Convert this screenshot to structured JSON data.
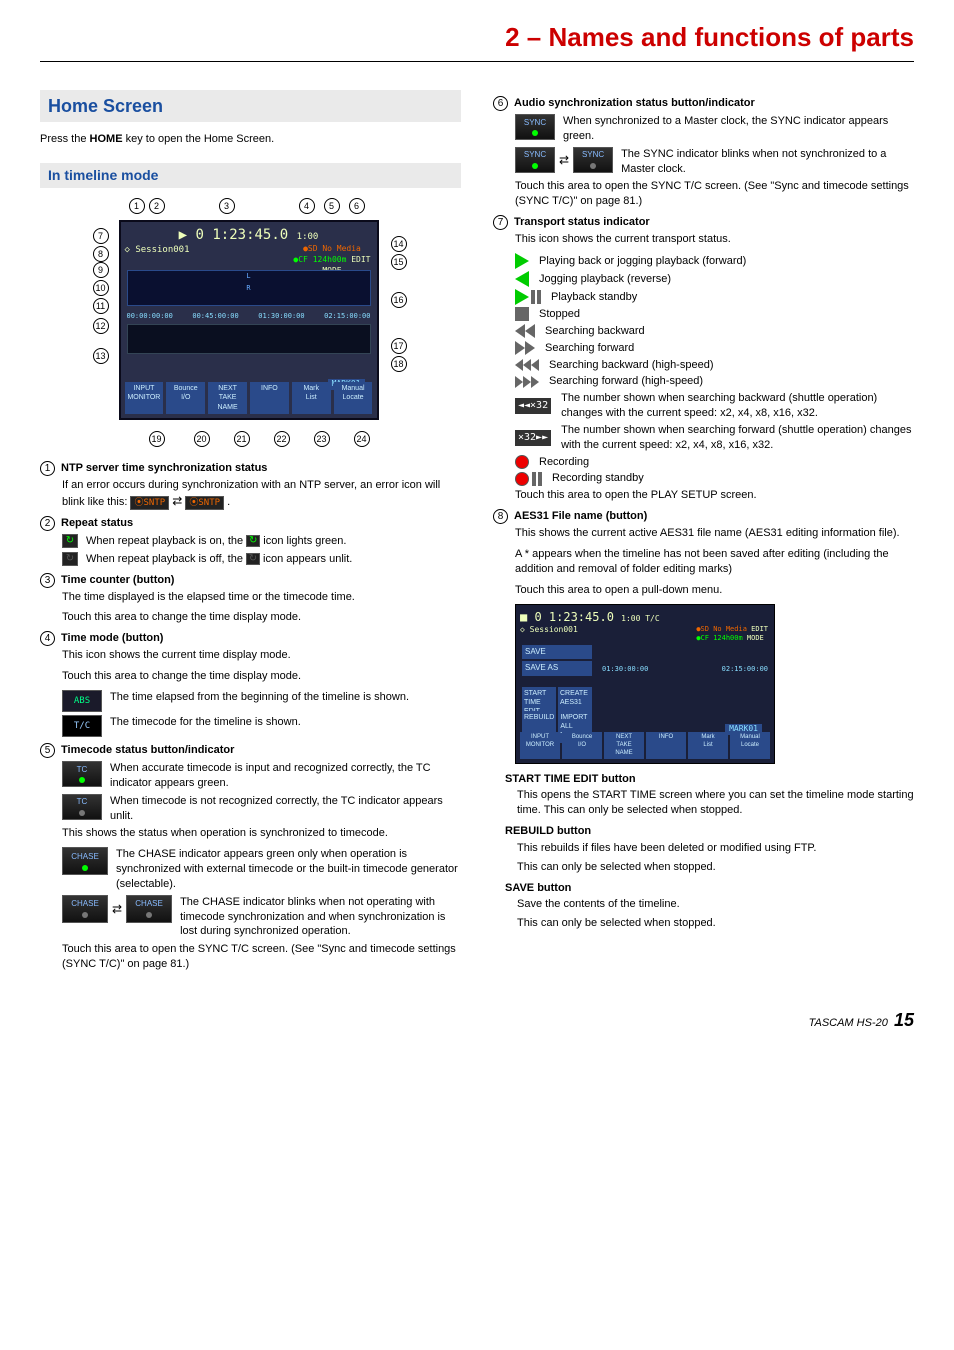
{
  "chapter_title": "2 – Names and functions of parts",
  "section": {
    "home_screen": "Home Screen",
    "timeline_mode": "In timeline mode"
  },
  "intro": {
    "prefix": "Press the ",
    "key": "HOME",
    "suffix": " key to open the Home Screen."
  },
  "callouts_top": [
    "1",
    "2",
    "3",
    "4",
    "5",
    "6"
  ],
  "callouts_left": [
    "7",
    "8",
    "9",
    "10",
    "11",
    "12",
    "13"
  ],
  "callouts_right": [
    "14",
    "15",
    "16",
    "17",
    "18"
  ],
  "callouts_bottom": [
    "19",
    "20",
    "21",
    "22",
    "23",
    "24"
  ],
  "col1": {
    "i1": {
      "num": "1",
      "title": "NTP server time synchronization status",
      "body": "If an error occurs during synchronization with an NTP server, an error icon will blink like this:",
      "sntp": "⦿SNTP",
      "dot": "."
    },
    "i2": {
      "num": "2",
      "title": "Repeat status",
      "on_a": "When repeat playback is on, the ",
      "on_b": " icon lights green.",
      "off_a": "When repeat playback is off, the ",
      "off_b": " icon appears unlit."
    },
    "i3": {
      "num": "3",
      "title": "Time counter (button)",
      "l1": "The time displayed is the elapsed time or the timecode time.",
      "l2": "Touch this area to change the time display mode."
    },
    "i4": {
      "num": "4",
      "title": "Time mode (button)",
      "l1": "This icon shows the current time display mode.",
      "l2": "Touch this area to change the time display mode.",
      "abs_label": "ABS",
      "abs_txt": "The time elapsed from the beginning of the timeline is shown.",
      "tc_label": "T/C",
      "tc_txt": "The timecode for the timeline is shown."
    },
    "i5": {
      "num": "5",
      "title": "Timecode status button/indicator",
      "tc_on": "When accurate timecode is input and recognized correctly, the TC indicator appears green.",
      "tc_off": "When timecode is not recognized correctly, the TC indicator appears unlit.",
      "status": "This shows the status when operation is synchronized to timecode.",
      "chase_on": "The CHASE indicator appears green only when operation is synchronized with external timecode or the built-in timecode generator (selectable).",
      "chase_off": "The CHASE indicator blinks when not operating with timecode synchronization and when synchronization is lost during synchronized operation.",
      "touch": "Touch this area to open the SYNC T/C screen. (See \"Sync and timecode settings (SYNC T/C)\" on page 81.)",
      "chase_label": "CHASE",
      "tc_label": "TC"
    }
  },
  "col2": {
    "i6": {
      "num": "6",
      "title": "Audio synchronization status button/indicator",
      "sync_label": "SYNC",
      "on": "When synchronized to a Master clock, the SYNC indicator appears green.",
      "off": "The SYNC indicator blinks when not synchronized to a Master clock.",
      "touch": "Touch this area to open the SYNC T/C screen. (See \"Sync and timecode settings (SYNC T/C)\" on page 81.)"
    },
    "i7": {
      "num": "7",
      "title": "Transport status indicator",
      "intro": "This icon shows the current transport status.",
      "play": "Playing back or jogging playback (forward)",
      "jogrev": "Jogging playback (reverse)",
      "standby": "Playback standby",
      "stop": "Stopped",
      "sback": "Searching backward",
      "sfwd": "Searching forward",
      "shback": "Searching backward (high-speed)",
      "shfwd": "Searching forward (high-speed)",
      "shuttle_back_label": "◄◄×32",
      "shuttle_back": "The number shown when searching backward (shuttle operation) changes with the current speed: x2, x4, x8, x16, x32.",
      "shuttle_fwd_label": "×32►►",
      "shuttle_fwd": "The number shown when searching forward (shuttle operation) changes with the current speed: x2, x4, x8, x16, x32.",
      "rec": "Recording",
      "recstby": "Recording standby",
      "touch": "Touch this area to open the PLAY SETUP screen."
    },
    "i8": {
      "num": "8",
      "title": "AES31 File name (button)",
      "l1": "This shows the current active AES31 file name (AES31 editing information file).",
      "l2": "A * appears when the timeline has not been saved after editing (including the addition and removal of folder editing marks)",
      "l3": "Touch this area to open a pull-down menu.",
      "pulldown_items": [
        "SAVE",
        "SAVE AS",
        "START TIME EDIT",
        "CREATE AES31",
        "REBUILD",
        "IMPORT ALL TAKES"
      ],
      "start_h": "START TIME EDIT button",
      "start_b": "This opens the START TIME screen where you can set the timeline mode starting time. This can only be selected when stopped.",
      "rebuild_h": "REBUILD button",
      "rebuild_b1": "This rebuilds if files have been deleted or modified using FTP.",
      "rebuild_b2": "This can only be selected when stopped.",
      "save_h": "SAVE button",
      "save_b1": "Save the contents of the timeline.",
      "save_b2": "This can only be selected when stopped."
    }
  },
  "footer": {
    "model": "TASCAM  HS-20",
    "page": "15"
  }
}
